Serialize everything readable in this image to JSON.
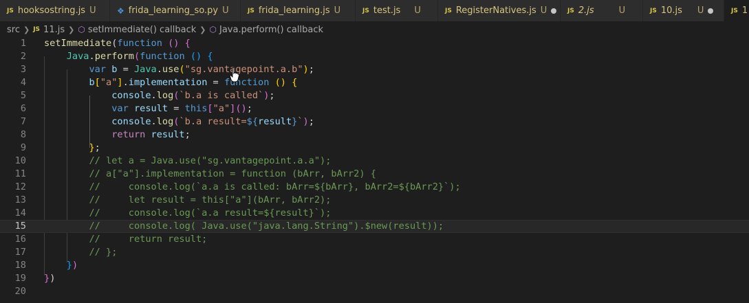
{
  "tabs": [
    {
      "icon": "JS",
      "name": "hooksostring.js",
      "status": "U",
      "dot": false,
      "italic": false,
      "active": false
    },
    {
      "icon": "PY",
      "name": "frida_learning_so.py",
      "status": "U",
      "dot": false,
      "italic": false,
      "active": false
    },
    {
      "icon": "JS",
      "name": "frida_learning.js",
      "status": "U",
      "dot": false,
      "italic": false,
      "active": false
    },
    {
      "icon": "JS",
      "name": "test.js",
      "status": "U",
      "dot": false,
      "italic": false,
      "active": false
    },
    {
      "icon": "JS",
      "name": "RegisterNatives.js",
      "status": "U",
      "dot": true,
      "italic": false,
      "active": false
    },
    {
      "icon": "JS",
      "name": "2.js",
      "status": "U",
      "dot": false,
      "italic": true,
      "active": false
    },
    {
      "icon": "JS",
      "name": "10.js",
      "status": "U",
      "dot": true,
      "italic": false,
      "active": false
    },
    {
      "icon": "JS",
      "name": "1",
      "status": "",
      "dot": false,
      "italic": false,
      "active": true
    }
  ],
  "breadcrumb": {
    "folder": "src",
    "file_icon": "JS",
    "file": "11.js",
    "symbol1": "setImmediate() callback",
    "symbol2": "Java.perform() callback"
  },
  "editor": {
    "current_line": 15,
    "lines": [
      {
        "n": "1",
        "t": [
          [
            "setImmediate",
            "#dcdcaa"
          ],
          [
            "(",
            "#d4d4d4"
          ],
          [
            "function",
            "#569cd6"
          ],
          [
            " ",
            "#d4d4d4"
          ],
          [
            "()",
            "#da70d6"
          ],
          [
            " ",
            "#d4d4d4"
          ],
          [
            "{",
            "#da70d6"
          ]
        ]
      },
      {
        "n": "2",
        "t": [
          [
            "    ",
            "#d4d4d4"
          ],
          [
            "Java",
            "#4ec9b0"
          ],
          [
            ".",
            "#d4d4d4"
          ],
          [
            "perform",
            "#dcdcaa"
          ],
          [
            "(",
            "#da70d6"
          ],
          [
            "function",
            "#569cd6"
          ],
          [
            " ",
            "#d4d4d4"
          ],
          [
            "()",
            "#179fff"
          ],
          [
            " ",
            "#d4d4d4"
          ],
          [
            "{",
            "#179fff"
          ]
        ]
      },
      {
        "n": "3",
        "t": [
          [
            "        ",
            "#d4d4d4"
          ],
          [
            "var",
            "#569cd6"
          ],
          [
            " ",
            "#d4d4d4"
          ],
          [
            "b",
            "#9cdcfe"
          ],
          [
            " = ",
            "#d4d4d4"
          ],
          [
            "Java",
            "#4ec9b0"
          ],
          [
            ".",
            "#d4d4d4"
          ],
          [
            "use",
            "#dcdcaa"
          ],
          [
            "(",
            "#ffd700"
          ],
          [
            "\"sg.vantagepoint.a.b\"",
            "#ce9178"
          ],
          [
            ")",
            "#ffd700"
          ],
          [
            ";",
            "#d4d4d4"
          ]
        ]
      },
      {
        "n": "4",
        "t": [
          [
            "        ",
            "#d4d4d4"
          ],
          [
            "b",
            "#9cdcfe"
          ],
          [
            "[",
            "#ffd700"
          ],
          [
            "\"a\"",
            "#ce9178"
          ],
          [
            "]",
            "#ffd700"
          ],
          [
            ".",
            "#d4d4d4"
          ],
          [
            "implementation",
            "#9cdcfe"
          ],
          [
            " = ",
            "#d4d4d4"
          ],
          [
            "function",
            "#569cd6"
          ],
          [
            " ",
            "#d4d4d4"
          ],
          [
            "()",
            "#ffd700"
          ],
          [
            " ",
            "#d4d4d4"
          ],
          [
            "{",
            "#ffd700"
          ]
        ]
      },
      {
        "n": "5",
        "t": [
          [
            "            ",
            "#d4d4d4"
          ],
          [
            "console",
            "#9cdcfe"
          ],
          [
            ".",
            "#d4d4d4"
          ],
          [
            "log",
            "#dcdcaa"
          ],
          [
            "(",
            "#da70d6"
          ],
          [
            "`b.a is called`",
            "#ce9178"
          ],
          [
            ")",
            "#da70d6"
          ],
          [
            ";",
            "#d4d4d4"
          ]
        ]
      },
      {
        "n": "6",
        "t": [
          [
            "            ",
            "#d4d4d4"
          ],
          [
            "var",
            "#569cd6"
          ],
          [
            " ",
            "#d4d4d4"
          ],
          [
            "result",
            "#9cdcfe"
          ],
          [
            " = ",
            "#d4d4d4"
          ],
          [
            "this",
            "#569cd6"
          ],
          [
            "[",
            "#da70d6"
          ],
          [
            "\"a\"",
            "#ce9178"
          ],
          [
            "]",
            "#da70d6"
          ],
          [
            "()",
            "#da70d6"
          ],
          [
            ";",
            "#d4d4d4"
          ]
        ]
      },
      {
        "n": "7",
        "t": [
          [
            "            ",
            "#d4d4d4"
          ],
          [
            "console",
            "#9cdcfe"
          ],
          [
            ".",
            "#d4d4d4"
          ],
          [
            "log",
            "#dcdcaa"
          ],
          [
            "(",
            "#da70d6"
          ],
          [
            "`b.a result=",
            "#ce9178"
          ],
          [
            "${",
            "#569cd6"
          ],
          [
            "result",
            "#9cdcfe"
          ],
          [
            "}",
            "#569cd6"
          ],
          [
            "`",
            "#ce9178"
          ],
          [
            ")",
            "#da70d6"
          ],
          [
            ";",
            "#d4d4d4"
          ]
        ]
      },
      {
        "n": "8",
        "t": [
          [
            "            ",
            "#d4d4d4"
          ],
          [
            "return",
            "#c586c0"
          ],
          [
            " ",
            "#d4d4d4"
          ],
          [
            "result",
            "#9cdcfe"
          ],
          [
            ";",
            "#d4d4d4"
          ]
        ]
      },
      {
        "n": "9",
        "t": [
          [
            "        ",
            "#d4d4d4"
          ],
          [
            "}",
            "#ffd700"
          ],
          [
            ";",
            "#d4d4d4"
          ]
        ]
      },
      {
        "n": "10",
        "t": [
          [
            "        ",
            "#d4d4d4"
          ],
          [
            "// let a = Java.use(\"sg.vantagepoint.a.a\");",
            "#6a9955"
          ]
        ]
      },
      {
        "n": "11",
        "t": [
          [
            "        ",
            "#d4d4d4"
          ],
          [
            "// a[\"a\"].implementation = function (bArr, bArr2) {",
            "#6a9955"
          ]
        ]
      },
      {
        "n": "12",
        "t": [
          [
            "        ",
            "#d4d4d4"
          ],
          [
            "//     console.log(`a.a is called: bArr=${bArr}, bArr2=${bArr2}`);",
            "#6a9955"
          ]
        ]
      },
      {
        "n": "13",
        "t": [
          [
            "        ",
            "#d4d4d4"
          ],
          [
            "//     let result = this[\"a\"](bArr, bArr2);",
            "#6a9955"
          ]
        ]
      },
      {
        "n": "14",
        "t": [
          [
            "        ",
            "#d4d4d4"
          ],
          [
            "//     console.log(`a.a result=${result}`);",
            "#6a9955"
          ]
        ]
      },
      {
        "n": "15",
        "t": [
          [
            "        ",
            "#d4d4d4"
          ],
          [
            "//     console.log( Java.use(\"java.lang.String\").$new(result));",
            "#6a9955"
          ]
        ]
      },
      {
        "n": "16",
        "t": [
          [
            "        ",
            "#d4d4d4"
          ],
          [
            "//     return result;",
            "#6a9955"
          ]
        ]
      },
      {
        "n": "17",
        "t": [
          [
            "        ",
            "#d4d4d4"
          ],
          [
            "// };",
            "#6a9955"
          ]
        ]
      },
      {
        "n": "18",
        "t": [
          [
            "    ",
            "#d4d4d4"
          ],
          [
            "}",
            "#179fff"
          ],
          [
            ")",
            "#da70d6"
          ]
        ]
      },
      {
        "n": "19",
        "t": [
          [
            "}",
            "#da70d6"
          ],
          [
            ")",
            "#d4d4d4"
          ]
        ]
      },
      {
        "n": "20",
        "t": []
      }
    ]
  },
  "colors": {
    "background": "#1e1e1e",
    "tabbar": "#252526",
    "keyword": "#569cd6",
    "string": "#ce9178",
    "comment": "#6a9955",
    "function": "#dcdcaa"
  }
}
